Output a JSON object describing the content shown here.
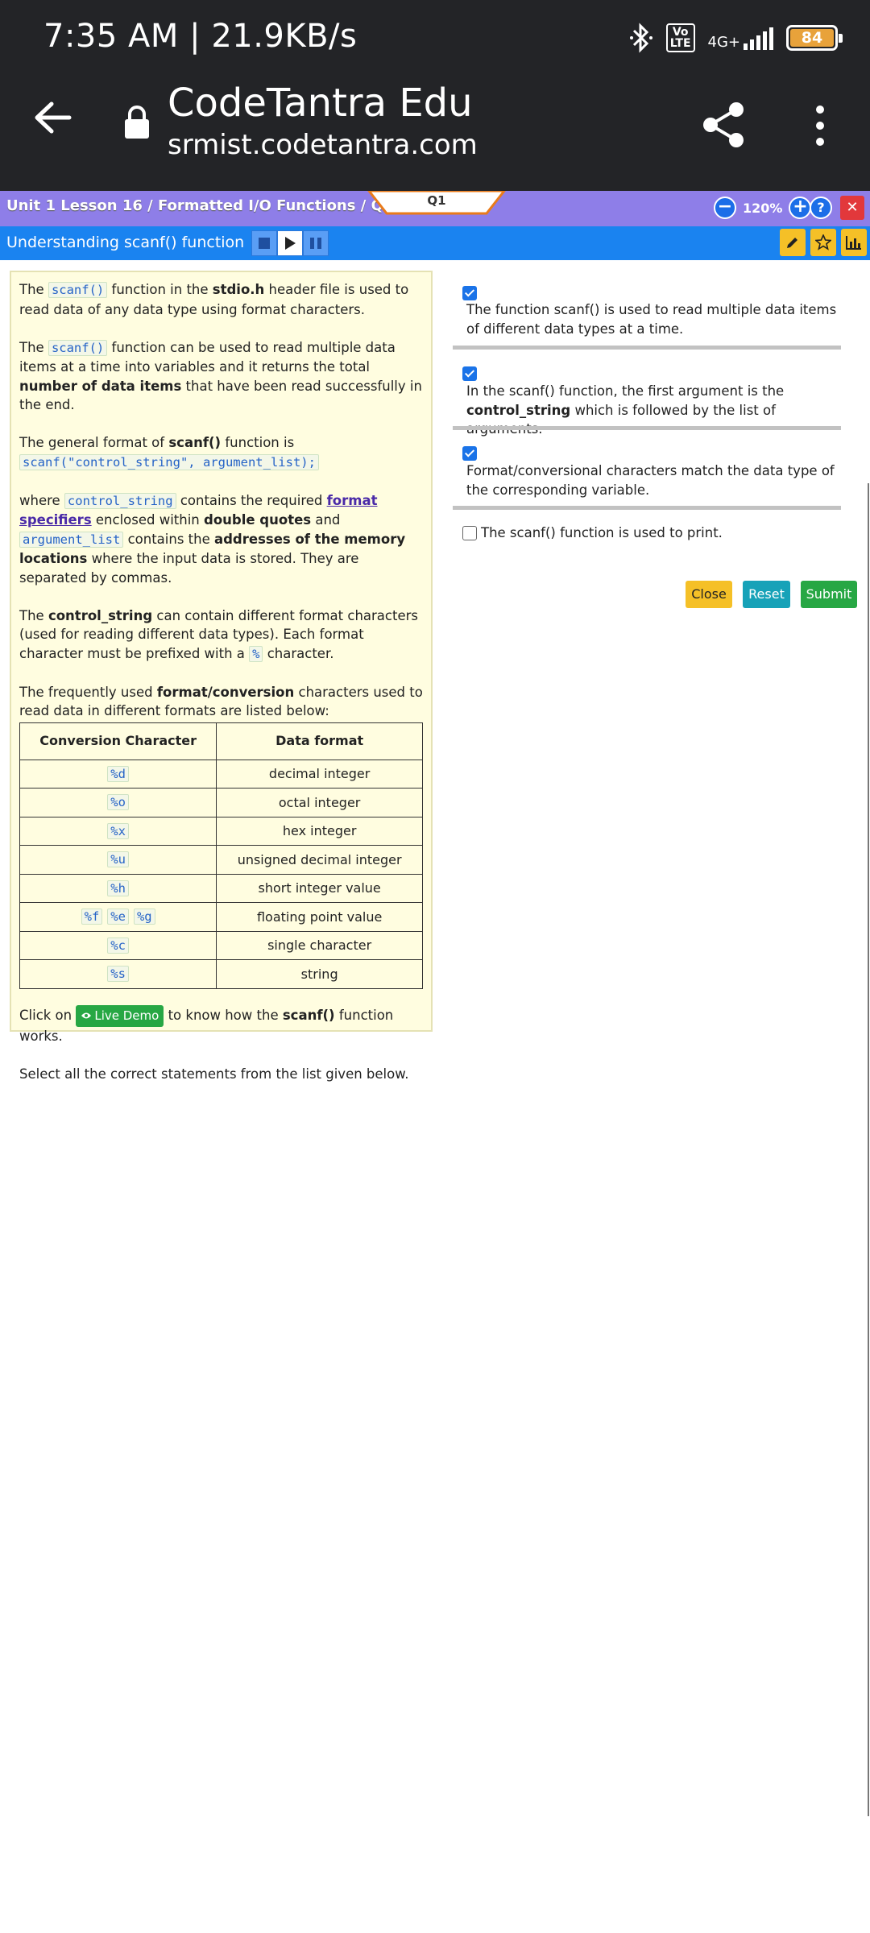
{
  "status": {
    "time": "7:35 AM | 21.9KB/s",
    "volte": "Vo\nLTE",
    "network": "4G+",
    "battery": "84"
  },
  "browser": {
    "title": "CodeTantra Edu",
    "url": "srmist.codetantra.com"
  },
  "lesson": {
    "breadcrumb": "Unit 1 Lesson 16 / Formatted I/O Functions / Q1",
    "question_tab": "Q1",
    "zoom": "120%",
    "help": "?",
    "close": "✕"
  },
  "topic": {
    "title": "Understanding scanf() function"
  },
  "content": {
    "p1": {
      "a": "The ",
      "code": "scanf()",
      "b": " function in the ",
      "bold": "stdio.h",
      "c": " header file is used to read data of any data type using format characters."
    },
    "p2": {
      "a": "The ",
      "code": "scanf()",
      "b": " function can be used to read multiple data items at a time into variables and it returns the total ",
      "bold": "number of data items",
      "c": " that have been read successfully in the end."
    },
    "p3": {
      "a": "The general format of ",
      "bold": "scanf()",
      "b": " function is",
      "code": "scanf(\"control_string\", argument_list);"
    },
    "p4": {
      "a": "where ",
      "code1": "control_string",
      "b": " contains the required ",
      "link": "format specifiers",
      "c": " enclosed within ",
      "bold1": "double quotes",
      "d": " and ",
      "code2": "argument_list",
      "e": " contains the ",
      "bold2": "addresses of the memory locations",
      "f": " where the input data is stored. They are separated by commas."
    },
    "p5": {
      "a": "The ",
      "bold": "control_string",
      "b": " can contain different format characters (used for reading different data types). Each format character must be prefixed with a ",
      "code": "%",
      "c": " character."
    },
    "p6": {
      "a": "The frequently used ",
      "bold": "format/conversion",
      "b": " characters used to read data in different formats are listed below:"
    },
    "table": {
      "headers": [
        "Conversion Character",
        "Data format"
      ],
      "rows": [
        {
          "chars": [
            "%d"
          ],
          "format": "decimal integer"
        },
        {
          "chars": [
            "%o"
          ],
          "format": "octal integer"
        },
        {
          "chars": [
            "%x"
          ],
          "format": "hex integer"
        },
        {
          "chars": [
            "%u"
          ],
          "format": "unsigned decimal integer"
        },
        {
          "chars": [
            "%h"
          ],
          "format": "short integer value"
        },
        {
          "chars": [
            "%f",
            "%e",
            "%g"
          ],
          "format": "floating point value"
        },
        {
          "chars": [
            "%c"
          ],
          "format": "single character"
        },
        {
          "chars": [
            "%s"
          ],
          "format": "string"
        }
      ]
    },
    "p7": {
      "a": "Click on ",
      "button": "Live Demo",
      "b": " to know how the ",
      "bold": "scanf()",
      "c": " function works."
    },
    "p8": "Select all the correct statements from the list given below."
  },
  "options": [
    {
      "checked": true,
      "text": "The function scanf() is used to read multiple data items of different data types at a time."
    },
    {
      "checked": true,
      "a": "In the scanf() function, the first argument is the ",
      "bold": "control_string",
      "b": " which is followed by the list of arguments."
    },
    {
      "checked": true,
      "text": "Format/conversional characters match the data type of the corresponding variable."
    },
    {
      "checked": false,
      "text": "The scanf() function is used to print."
    }
  ],
  "buttons": {
    "close": "Close",
    "reset": "Reset",
    "submit": "Submit"
  },
  "colors": {
    "status_bg": "#232427",
    "lesson_bar": "#8e7ee8",
    "topic_bar": "#1a83f0",
    "panel_bg": "#fffde0",
    "close_btn": "#f5c027",
    "reset_btn": "#17a2b8",
    "submit_btn": "#27a744"
  }
}
